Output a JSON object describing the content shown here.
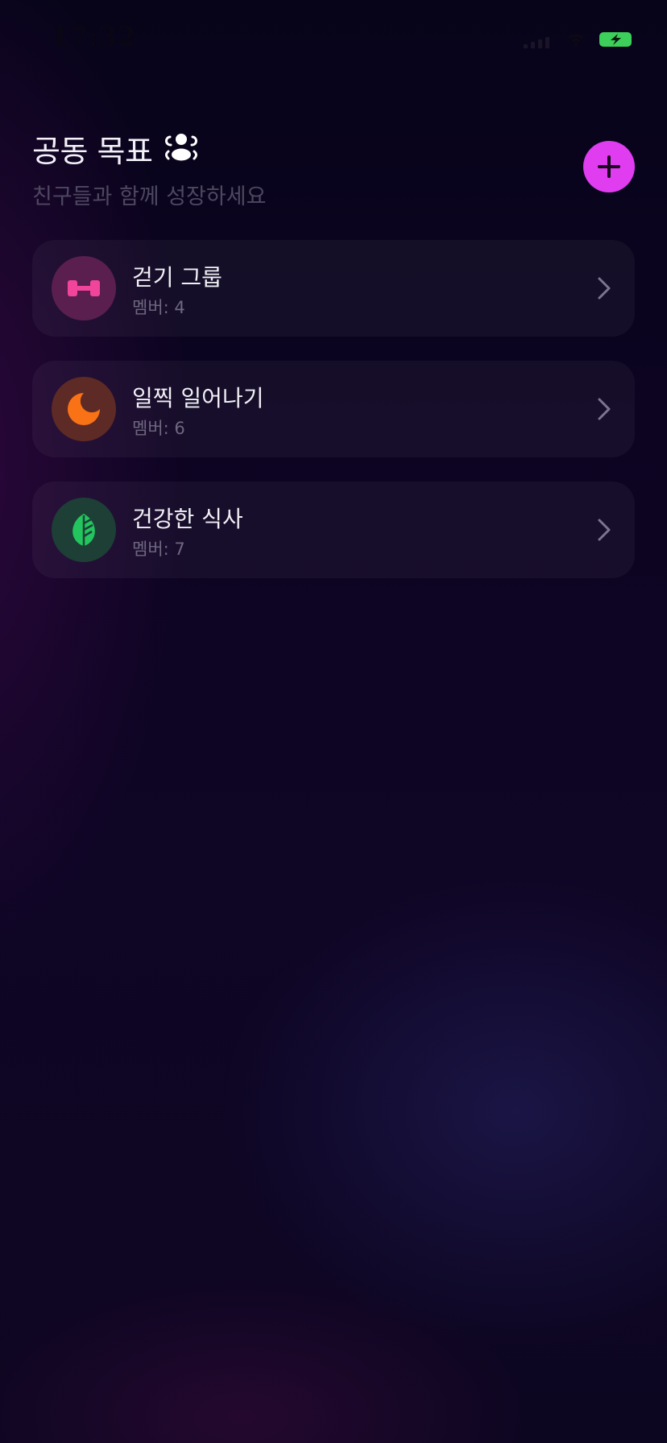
{
  "status_bar": {
    "time": "17:32",
    "battery_color": "#3ccf5a"
  },
  "header": {
    "title": "공동 목표",
    "subtitle": "친구들과 함께 성장하세요",
    "title_icon": "people-icon"
  },
  "add_button": {
    "icon": "plus-icon",
    "color": "#e03cf0"
  },
  "groups": [
    {
      "name": "걷기 그룹",
      "members": "멤버: 4",
      "icon": "dumbbell-icon",
      "icon_color": "#f0459a",
      "icon_bg": "#5a1f4f"
    },
    {
      "name": "일찍 일어나기",
      "members": "멤버: 6",
      "icon": "moon-icon",
      "icon_color": "#f97316",
      "icon_bg": "#5e2a25"
    },
    {
      "name": "건강한 식사",
      "members": "멤버: 7",
      "icon": "leaf-icon",
      "icon_color": "#22c55e",
      "icon_bg": "#1d3f36"
    }
  ]
}
